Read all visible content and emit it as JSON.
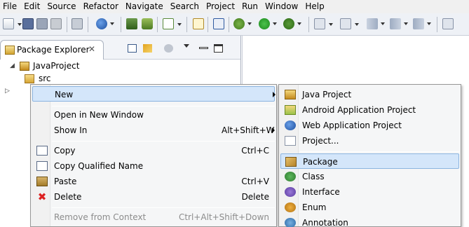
{
  "menubar": {
    "items": [
      "File",
      "Edit",
      "Source",
      "Refactor",
      "Navigate",
      "Search",
      "Project",
      "Run",
      "Window",
      "Help"
    ]
  },
  "toolbar": {
    "icons": [
      "new-wizard-icon",
      "save-icon",
      "save-all-icon",
      "print-icon",
      "open-type-icon",
      "web-app-icon",
      "sdk-manager-icon",
      "avd-manager-icon",
      "task-icon",
      "new-java-project-icon",
      "skip-breakpoints-icon",
      "debug-icon",
      "run-icon",
      "external-tools-icon",
      "next-annotation-icon",
      "previous-annotation-icon",
      "back-icon",
      "forward-icon",
      "pin-editor-icon"
    ]
  },
  "package_explorer": {
    "title": "Package Explorer",
    "tree": {
      "project": "JavaProject",
      "src": "src"
    }
  },
  "context_menu": {
    "items": [
      {
        "label": "New",
        "accel": "",
        "submenu": true
      },
      {
        "label": "Open in New Window",
        "accel": ""
      },
      {
        "label": "Show In",
        "accel": "Alt+Shift+W",
        "submenu": true
      },
      {
        "label": "Copy",
        "accel": "Ctrl+C"
      },
      {
        "label": "Copy Qualified Name",
        "accel": ""
      },
      {
        "label": "Paste",
        "accel": "Ctrl+V"
      },
      {
        "label": "Delete",
        "accel": "Delete"
      },
      {
        "label": "Remove from Context",
        "accel": "Ctrl+Alt+Shift+Down",
        "disabled": true
      }
    ]
  },
  "submenu": {
    "items": [
      {
        "label": "Java Project"
      },
      {
        "label": "Android Application Project"
      },
      {
        "label": "Web Application Project"
      },
      {
        "label": "Project..."
      },
      {
        "label": "Package",
        "selected": true
      },
      {
        "label": "Class"
      },
      {
        "label": "Interface"
      },
      {
        "label": "Enum"
      },
      {
        "label": "Annotation"
      }
    ]
  },
  "colors": {
    "selection_bg": "#d4e6fa",
    "selection_border": "#8bb4e0",
    "menu_bg": "#f5f6f7",
    "toolbar_bg": "#eef1f6"
  }
}
